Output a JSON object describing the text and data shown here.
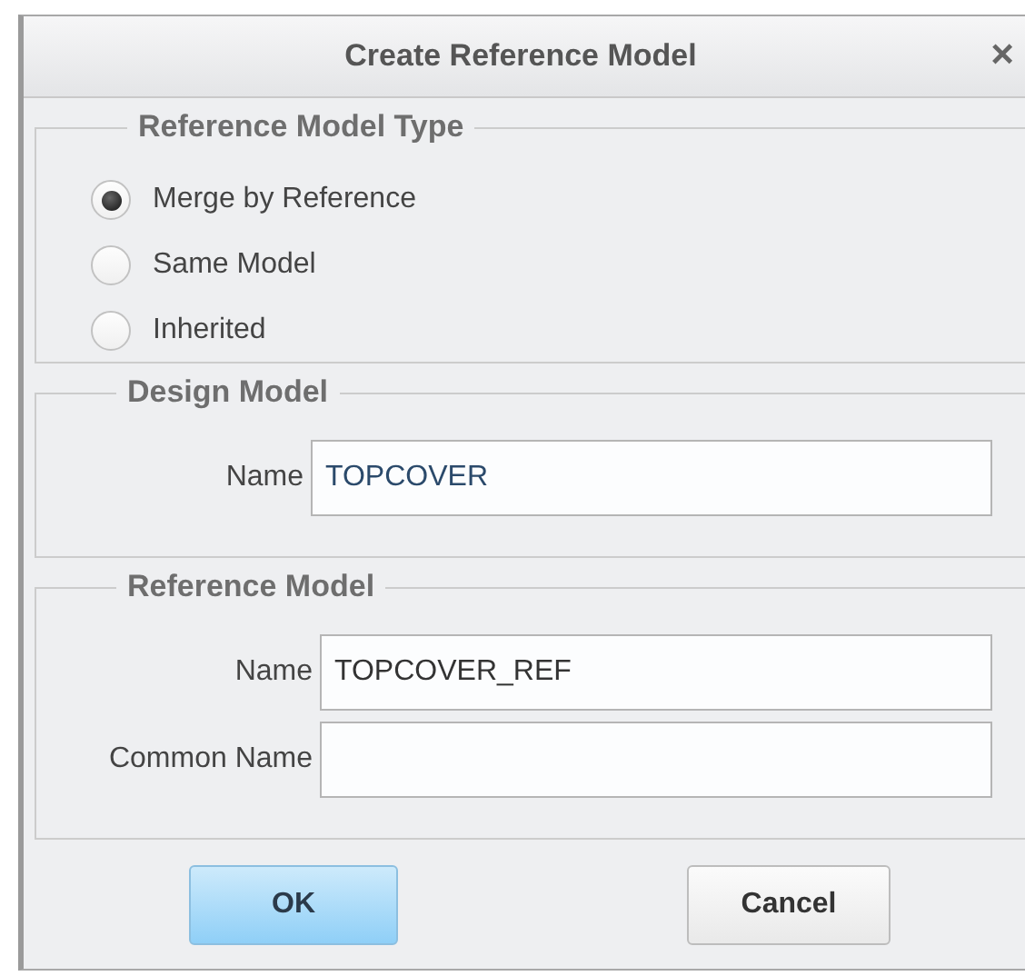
{
  "window": {
    "title": "Create Reference Model",
    "close": "×"
  },
  "reference_model_type": {
    "legend": "Reference Model Type",
    "options": [
      {
        "label": "Merge by Reference",
        "selected": true
      },
      {
        "label": "Same Model",
        "selected": false
      },
      {
        "label": "Inherited",
        "selected": false
      }
    ]
  },
  "design_model": {
    "legend": "Design Model",
    "fields": [
      {
        "label": "Name",
        "value": "TOPCOVER"
      }
    ]
  },
  "reference_model": {
    "legend": "Reference Model",
    "fields": [
      {
        "label": "Name",
        "value": "TOPCOVER_REF"
      },
      {
        "label": "Common Name"
      }
    ]
  },
  "buttons": [
    {
      "label": "OK",
      "kind": "primary"
    },
    {
      "label": "Cancel",
      "kind": "secondary"
    }
  ]
}
